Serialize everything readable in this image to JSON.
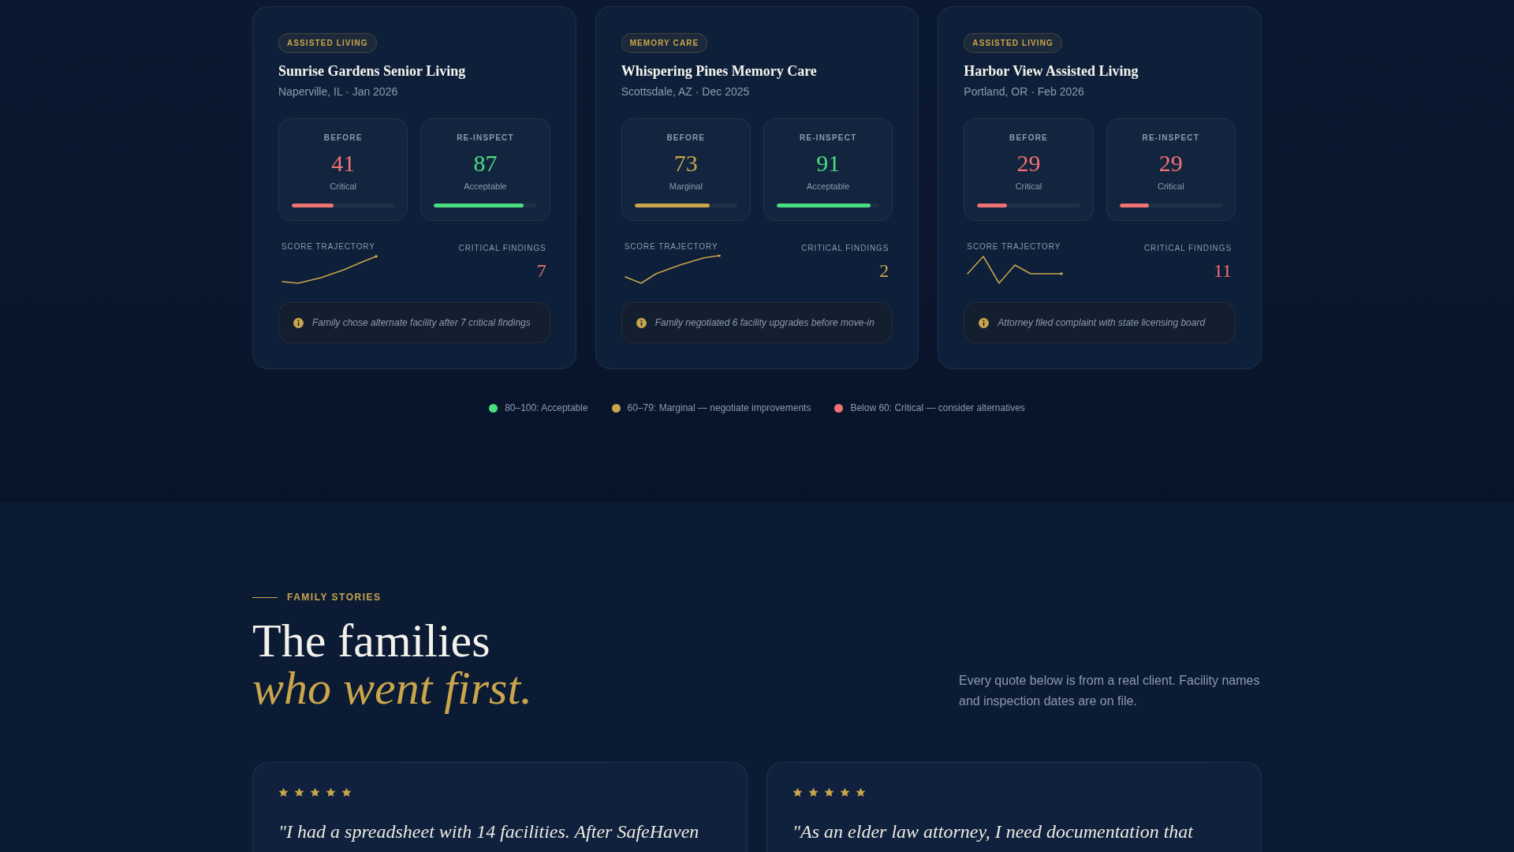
{
  "facilities": [
    {
      "category": "ASSISTED LIVING",
      "name": "Sunrise Gardens Senior Living",
      "location": "Naperville, IL · Jan 2026",
      "scores": [
        {
          "label": "BEFORE",
          "value": "41",
          "status": "Critical",
          "kind": "critical",
          "level": 0.41
        },
        {
          "label": "RE-INSPECT",
          "value": "87",
          "status": "Acceptable",
          "kind": "acceptable",
          "level": 0.87
        }
      ],
      "trajectory_label": "SCORE TRAJECTORY",
      "findings": {
        "label": "CRITICAL FINDINGS",
        "value": "7",
        "kind": "critical"
      },
      "note": "Family chose alternate facility after 7 critical findings"
    },
    {
      "category": "MEMORY CARE",
      "name": "Whispering Pines Memory Care",
      "location": "Scottsdale, AZ · Dec 2025",
      "scores": [
        {
          "label": "BEFORE",
          "value": "73",
          "status": "Marginal",
          "kind": "marginal",
          "level": 0.73
        },
        {
          "label": "RE-INSPECT",
          "value": "91",
          "status": "Acceptable",
          "kind": "acceptable",
          "level": 0.91
        }
      ],
      "trajectory_label": "SCORE TRAJECTORY",
      "findings": {
        "label": "CRITICAL FINDINGS",
        "value": "2",
        "kind": "marginal"
      },
      "note": "Family negotiated 6 facility upgrades before move-in"
    },
    {
      "category": "ASSISTED LIVING",
      "name": "Harbor View Assisted Living",
      "location": "Portland, OR · Feb 2026",
      "scores": [
        {
          "label": "BEFORE",
          "value": "29",
          "status": "Critical",
          "kind": "critical",
          "level": 0.29
        },
        {
          "label": "RE-INSPECT",
          "value": "29",
          "status": "Critical",
          "kind": "critical",
          "level": 0.29
        }
      ],
      "trajectory_label": "SCORE TRAJECTORY",
      "findings": {
        "label": "CRITICAL FINDINGS",
        "value": "11",
        "kind": "critical"
      },
      "note": "Attorney filed complaint with state licensing board"
    }
  ],
  "legend": [
    {
      "label": "80–100: Acceptable",
      "color": "#4ade80"
    },
    {
      "label": "60–79: Marginal — negotiate improvements",
      "color": "#c9a54c"
    },
    {
      "label": "Below 60: Critical — consider alternatives",
      "color": "#f07272"
    }
  ],
  "stories": {
    "eyebrow": "FAMILY STORIES",
    "title": "The families",
    "title_accent": "who went first.",
    "intro": "Every quote below is from a real client. Facility names and inspection dates are on file.",
    "testimonials": [
      {
        "stars": 5,
        "quote": "\"I had a spreadsheet with 14 facilities. After SafeHaven"
      },
      {
        "stars": 5,
        "quote": "\"As an elder law attorney, I need documentation that"
      }
    ]
  }
}
